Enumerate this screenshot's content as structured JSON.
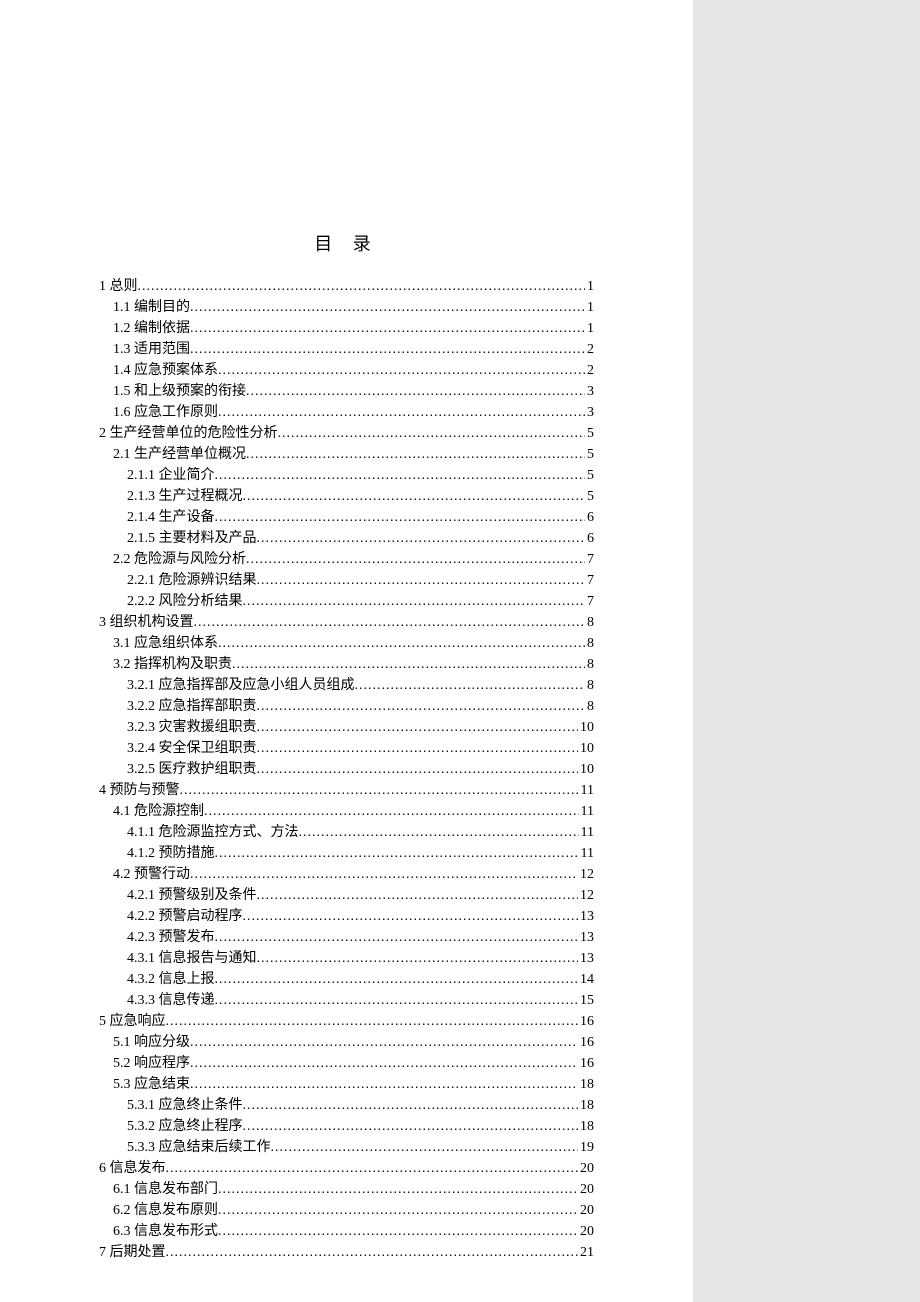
{
  "title": "目  录",
  "toc": [
    {
      "level": 0,
      "label": "1 总则",
      "page": "1"
    },
    {
      "level": 1,
      "label": "1.1 编制目的",
      "page": "1"
    },
    {
      "level": 1,
      "label": "1.2 编制依据",
      "page": "1"
    },
    {
      "level": 1,
      "label": "1.3 适用范围",
      "page": "2"
    },
    {
      "level": 1,
      "label": "1.4 应急预案体系",
      "page": "2"
    },
    {
      "level": 1,
      "label": "1.5 和上级预案的衔接",
      "page": "3"
    },
    {
      "level": 1,
      "label": "1.6 应急工作原则",
      "page": "3"
    },
    {
      "level": 0,
      "label": "2 生产经营单位的危险性分析",
      "page": "5"
    },
    {
      "level": 1,
      "label": "2.1 生产经营单位概况",
      "page": "5"
    },
    {
      "level": 2,
      "label": "2.1.1 企业简介",
      "page": "5"
    },
    {
      "level": 2,
      "label": "2.1.3 生产过程概况",
      "page": "5"
    },
    {
      "level": 2,
      "label": "2.1.4 生产设备",
      "page": "6"
    },
    {
      "level": 2,
      "label": "2.1.5 主要材料及产品",
      "page": "6"
    },
    {
      "level": 1,
      "label": "2.2 危险源与风险分析",
      "page": "7"
    },
    {
      "level": 2,
      "label": "2.2.1 危险源辨识结果",
      "page": "7"
    },
    {
      "level": 2,
      "label": "2.2.2 风险分析结果",
      "page": "7"
    },
    {
      "level": 0,
      "label": "3 组织机构设置",
      "page": "8"
    },
    {
      "level": 1,
      "label": "3.1 应急组织体系",
      "page": "8"
    },
    {
      "level": 1,
      "label": "3.2 指挥机构及职责",
      "page": "8"
    },
    {
      "level": 2,
      "label": "3.2.1 应急指挥部及应急小组人员组成",
      "page": "8"
    },
    {
      "level": 2,
      "label": "3.2.2 应急指挥部职责",
      "page": "8"
    },
    {
      "level": 2,
      "label": "3.2.3 灾害救援组职责",
      "page": "10"
    },
    {
      "level": 2,
      "label": "3.2.4 安全保卫组职责",
      "page": "10"
    },
    {
      "level": 2,
      "label": "3.2.5 医疗救护组职责",
      "page": "10"
    },
    {
      "level": 0,
      "label": "4 预防与预警",
      "page": "11"
    },
    {
      "level": 1,
      "label": "4.1 危险源控制",
      "page": "11"
    },
    {
      "level": 2,
      "label": "4.1.1 危险源监控方式、方法",
      "page": "11"
    },
    {
      "level": 2,
      "label": "4.1.2 预防措施",
      "page": "11"
    },
    {
      "level": 1,
      "label": "4.2 预警行动",
      "page": "12"
    },
    {
      "level": 2,
      "label": "4.2.1 预警级别及条件",
      "page": "12"
    },
    {
      "level": 2,
      "label": "4.2.2 预警启动程序",
      "page": "13"
    },
    {
      "level": 2,
      "label": "4.2.3 预警发布",
      "page": "13"
    },
    {
      "level": 2,
      "label": "4.3.1 信息报告与通知",
      "page": "13"
    },
    {
      "level": 2,
      "label": "4.3.2 信息上报",
      "page": "14"
    },
    {
      "level": 2,
      "label": "4.3.3 信息传递",
      "page": "15"
    },
    {
      "level": 0,
      "label": "5 应急响应",
      "page": "16"
    },
    {
      "level": 1,
      "label": "5.1 响应分级",
      "page": "16"
    },
    {
      "level": 1,
      "label": "5.2 响应程序",
      "page": "16"
    },
    {
      "level": 1,
      "label": "5.3 应急结束",
      "page": "18"
    },
    {
      "level": 2,
      "label": "5.3.1 应急终止条件",
      "page": "18"
    },
    {
      "level": 2,
      "label": "5.3.2 应急终止程序",
      "page": "18"
    },
    {
      "level": 2,
      "label": "5.3.3 应急结束后续工作",
      "page": "19"
    },
    {
      "level": 0,
      "label": "6 信息发布",
      "page": "20"
    },
    {
      "level": 1,
      "label": "6.1 信息发布部门",
      "page": "20"
    },
    {
      "level": 1,
      "label": "6.2 信息发布原则",
      "page": "20"
    },
    {
      "level": 1,
      "label": "6.3 信息发布形式",
      "page": "20"
    },
    {
      "level": 0,
      "label": "7 后期处置",
      "page": "21"
    }
  ]
}
